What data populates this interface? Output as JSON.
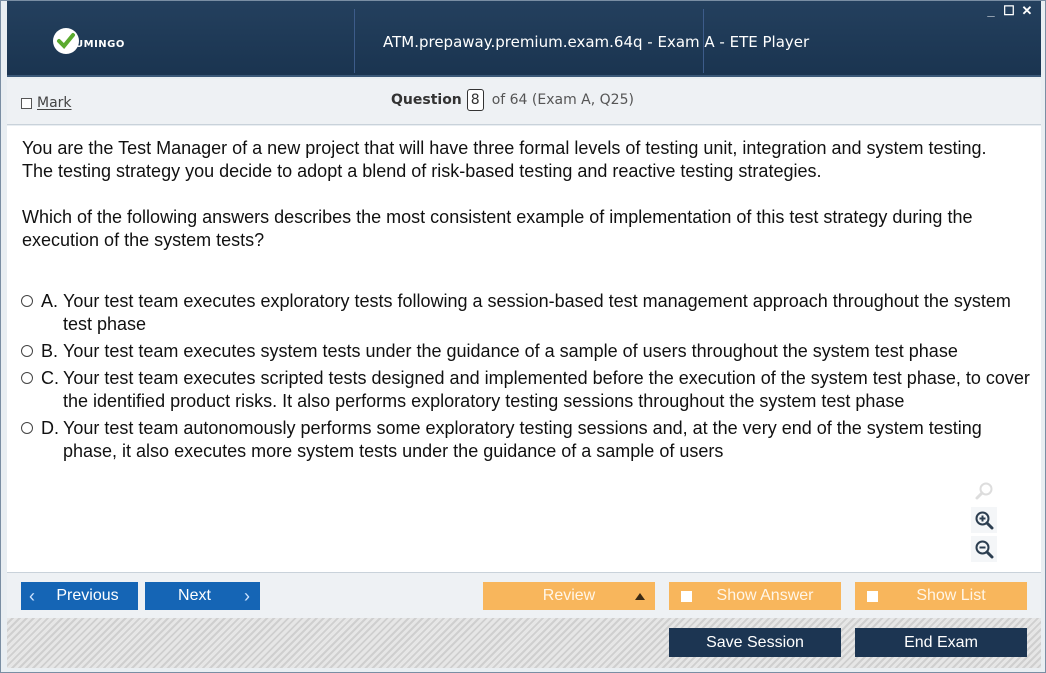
{
  "window": {
    "title": "ATM.prepaway.premium.exam.64q - Exam A - ETE Player",
    "logo_text": "UMINGO",
    "controls": [
      "_",
      "☐",
      "✕"
    ]
  },
  "header": {
    "mark_label": "Mark",
    "question_label": "Question",
    "question_number": "8",
    "question_of": "of 64 (Exam A, Q25)"
  },
  "question": {
    "paragraph1": "You are the Test Manager of a new project that will have three formal levels of testing unit, integration and system testing. The testing strategy you decide to adopt a blend of risk-based testing and reactive testing strategies.",
    "paragraph2": "Which of the following answers describes the most consistent example of implementation of this test strategy during the execution of the system tests?",
    "options": [
      {
        "letter": "A.",
        "text": "Your test team executes exploratory tests following a session-based test management approach throughout the system test phase"
      },
      {
        "letter": "B.",
        "text": "Your test team executes system tests under the guidance of a sample of users throughout the system test phase"
      },
      {
        "letter": "C.",
        "text": "Your test team executes scripted tests designed and implemented before the execution of the system test phase, to cover the identified product risks. It also performs exploratory testing sessions throughout the system test phase"
      },
      {
        "letter": "D.",
        "text": "Your test team autonomously performs some exploratory testing sessions and, at the very end of the system testing phase, it also executes more system tests under the guidance of a sample of users"
      }
    ]
  },
  "zoom": {
    "icons": [
      "search-icon",
      "zoom-in-icon",
      "zoom-out-icon"
    ]
  },
  "nav": {
    "previous_label": "Previous",
    "next_label": "Next",
    "review_label": "Review",
    "show_answer_label": "Show Answer",
    "show_list_label": "Show List",
    "save_session_label": "Save Session",
    "end_exam_label": "End Exam"
  },
  "colors": {
    "title_bar": "#1a3450",
    "nav_blue": "#1565b5",
    "nav_orange": "#f8b65c",
    "dark_button": "#1c3552"
  }
}
